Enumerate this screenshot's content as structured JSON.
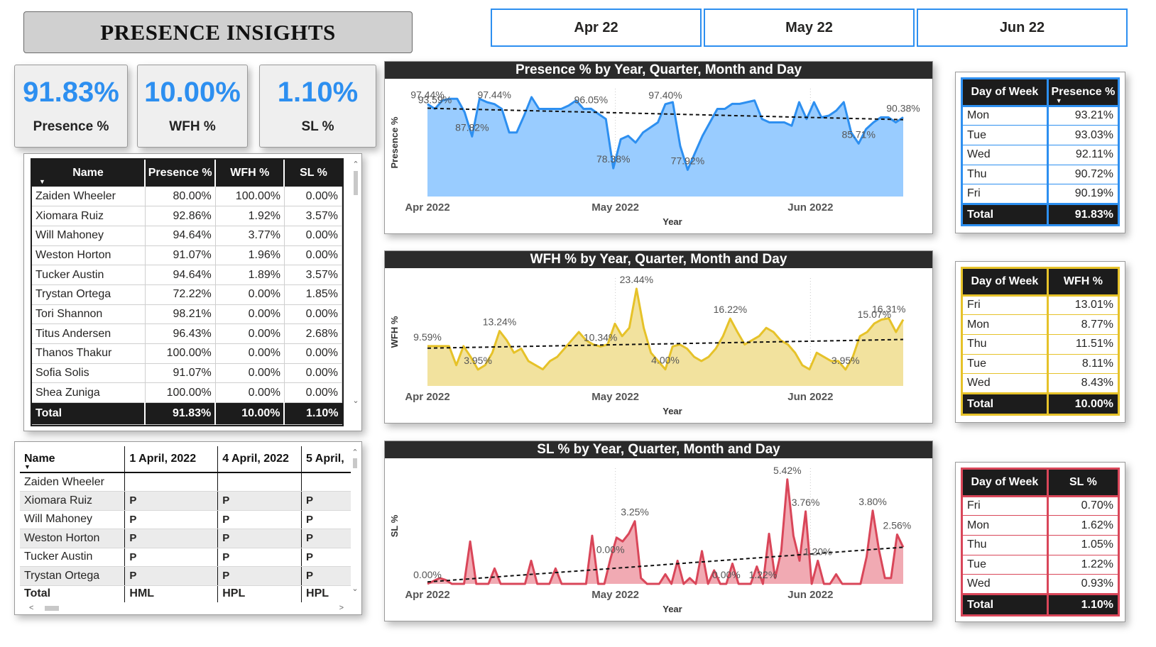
{
  "title": "PRESENCE INSIGHTS",
  "months": [
    "Apr 22",
    "May 22",
    "Jun 22"
  ],
  "kpis": [
    {
      "value": "91.83%",
      "label": "Presence %"
    },
    {
      "value": "10.00%",
      "label": "WFH %"
    },
    {
      "value": "1.10%",
      "label": "SL %"
    }
  ],
  "employee_table": {
    "columns": [
      "Name",
      "Presence %",
      "WFH %",
      "SL %"
    ],
    "rows": [
      [
        "Zaiden Wheeler",
        "80.00%",
        "100.00%",
        "0.00%"
      ],
      [
        "Xiomara Ruiz",
        "92.86%",
        "1.92%",
        "3.57%"
      ],
      [
        "Will Mahoney",
        "94.64%",
        "3.77%",
        "0.00%"
      ],
      [
        "Weston Horton",
        "91.07%",
        "1.96%",
        "0.00%"
      ],
      [
        "Tucker Austin",
        "94.64%",
        "1.89%",
        "3.57%"
      ],
      [
        "Trystan Ortega",
        "72.22%",
        "0.00%",
        "1.85%"
      ],
      [
        "Tori Shannon",
        "98.21%",
        "0.00%",
        "0.00%"
      ],
      [
        "Titus Andersen",
        "96.43%",
        "0.00%",
        "2.68%"
      ],
      [
        "Thanos Thakur",
        "100.00%",
        "0.00%",
        "0.00%"
      ],
      [
        "Sofia Solis",
        "91.07%",
        "0.00%",
        "0.00%"
      ],
      [
        "Shea Zuniga",
        "100.00%",
        "0.00%",
        "0.00%"
      ]
    ],
    "total": [
      "Total",
      "91.83%",
      "10.00%",
      "1.10%"
    ]
  },
  "attendance_table": {
    "columns": [
      "Name",
      "1 April, 2022",
      "4 April, 2022",
      "5 April,"
    ],
    "rows": [
      [
        "Zaiden Wheeler",
        "",
        "",
        ""
      ],
      [
        "Xiomara Ruiz",
        "P",
        "P",
        "P"
      ],
      [
        "Will Mahoney",
        "P",
        "P",
        "P"
      ],
      [
        "Weston Horton",
        "P",
        "P",
        "P"
      ],
      [
        "Tucker Austin",
        "P",
        "P",
        "P"
      ],
      [
        "Trystan Ortega",
        "P",
        "P",
        "P"
      ]
    ],
    "total": [
      "Total",
      "HML",
      "HPL",
      "HPL"
    ]
  },
  "chart_data": [
    {
      "type": "area",
      "title": "Presence % by Year, Quarter, Month and Day",
      "xlabel": "Year",
      "ylabel": "Presence %",
      "x_ticks": [
        "Apr 2022",
        "May 2022",
        "Jun 2022"
      ],
      "ylim": [
        70,
        102
      ],
      "color": "#2d8ff0",
      "fill": "#99ccff",
      "values": [
        97.44,
        96,
        98.5,
        99,
        99,
        95,
        87.82,
        99,
        98,
        97.44,
        96,
        89,
        89,
        94,
        99.5,
        96,
        96,
        96,
        96,
        97,
        98.5,
        96,
        96.05,
        94.5,
        93,
        78.38,
        87,
        88,
        86,
        89,
        90.5,
        92,
        97.4,
        98,
        85,
        77.92,
        83,
        88,
        92,
        96,
        96,
        97.5,
        97.5,
        98,
        98.5,
        93,
        92,
        92,
        92,
        91,
        98,
        93,
        98,
        93.5,
        94,
        95.5,
        98,
        89,
        85.71,
        90,
        92,
        93.5,
        93.5,
        92,
        93.5
      ],
      "trend": [
        96.2,
        92.8
      ],
      "labels": [
        "97.44%",
        "93.59%",
        "87.82%",
        "97.44%",
        "96.05%",
        "78.38%",
        "97.40%",
        "77.92%",
        "85.71%",
        "90.38%"
      ]
    },
    {
      "type": "area",
      "title": "WFH % by Year, Quarter, Month and Day",
      "xlabel": "Year",
      "ylabel": "WFH %",
      "x_ticks": [
        "Apr 2022",
        "May 2022",
        "Jun 2022"
      ],
      "ylim": [
        0,
        26
      ],
      "color": "#e6c229",
      "fill": "#f2e29e",
      "values": [
        9.59,
        9.59,
        9.59,
        9.59,
        5,
        9.59,
        7,
        3.95,
        5,
        8,
        13.24,
        11,
        8,
        9,
        6,
        5,
        4,
        6,
        7,
        9,
        11,
        13,
        11,
        10,
        9.5,
        10,
        15,
        12,
        14,
        23.44,
        14,
        8,
        6,
        4,
        9.5,
        10,
        9,
        7,
        6,
        7,
        9,
        12,
        16.22,
        13,
        10,
        11,
        12,
        14,
        13,
        11,
        10,
        8,
        5,
        4,
        8,
        7,
        6,
        6,
        3.95,
        7,
        12,
        13,
        15.07,
        16,
        16.31,
        13,
        16
      ],
      "trend": [
        9.1,
        11.2
      ],
      "labels": [
        "9.59%",
        "13.24%",
        "3.95%",
        "23.44%",
        "10.34%",
        "4.00%",
        "16.22%",
        "3.95%",
        "16.31%",
        "15.07%"
      ]
    },
    {
      "type": "area",
      "title": "SL % by Year, Quarter, Month and Day",
      "xlabel": "Year",
      "ylabel": "SL %",
      "x_ticks": [
        "Apr 2022",
        "May 2022",
        "Jun 2022"
      ],
      "ylim": [
        0,
        6
      ],
      "color": "#d94659",
      "fill": "#f1aab3",
      "values": [
        0,
        0.15,
        0.3,
        0.2,
        0,
        0,
        0,
        2.2,
        0,
        0,
        0,
        0.8,
        0,
        0,
        0,
        0,
        0,
        1.2,
        0,
        0,
        0,
        0.8,
        0,
        0,
        0,
        0,
        0,
        2.5,
        0,
        0,
        1.3,
        2.4,
        2.2,
        2.6,
        3.25,
        0.3,
        0,
        0,
        0,
        0.5,
        0,
        1.2,
        0,
        0.3,
        0,
        1.7,
        0,
        0.7,
        0,
        0,
        1.05,
        0,
        0,
        0,
        0.9,
        0,
        2.6,
        0.3,
        1.7,
        5.42,
        2.5,
        1.2,
        3.76,
        0,
        1.2,
        0,
        0,
        0.5,
        0,
        0,
        0,
        0,
        1.4,
        3.8,
        1.8,
        0.3,
        0.3,
        2.56,
        1.9
      ],
      "trend": [
        0.1,
        1.9
      ],
      "labels": [
        "0.00%",
        "3.25%",
        "0.00%",
        "0.00%",
        "1.22%",
        "5.42%",
        "3.76%",
        "1.20%",
        "3.80%",
        "2.56%"
      ]
    }
  ],
  "dow_tables": [
    {
      "color": "#2d8ff0",
      "columns": [
        "Day of Week",
        "Presence %"
      ],
      "rows": [
        [
          "Mon",
          "93.21%"
        ],
        [
          "Tue",
          "93.03%"
        ],
        [
          "Wed",
          "92.11%"
        ],
        [
          "Thu",
          "90.72%"
        ],
        [
          "Fri",
          "90.19%"
        ]
      ],
      "total": [
        "Total",
        "91.83%"
      ]
    },
    {
      "color": "#e6c229",
      "columns": [
        "Day of Week",
        "WFH %"
      ],
      "rows": [
        [
          "Fri",
          "13.01%"
        ],
        [
          "Mon",
          "8.77%"
        ],
        [
          "Thu",
          "11.51%"
        ],
        [
          "Tue",
          "8.11%"
        ],
        [
          "Wed",
          "8.43%"
        ]
      ],
      "total": [
        "Total",
        "10.00%"
      ]
    },
    {
      "color": "#d94659",
      "columns": [
        "Day of Week",
        "SL %"
      ],
      "rows": [
        [
          "Fri",
          "0.70%"
        ],
        [
          "Mon",
          "1.62%"
        ],
        [
          "Thu",
          "1.05%"
        ],
        [
          "Tue",
          "1.22%"
        ],
        [
          "Wed",
          "0.93%"
        ]
      ],
      "total": [
        "Total",
        "1.10%"
      ]
    }
  ]
}
